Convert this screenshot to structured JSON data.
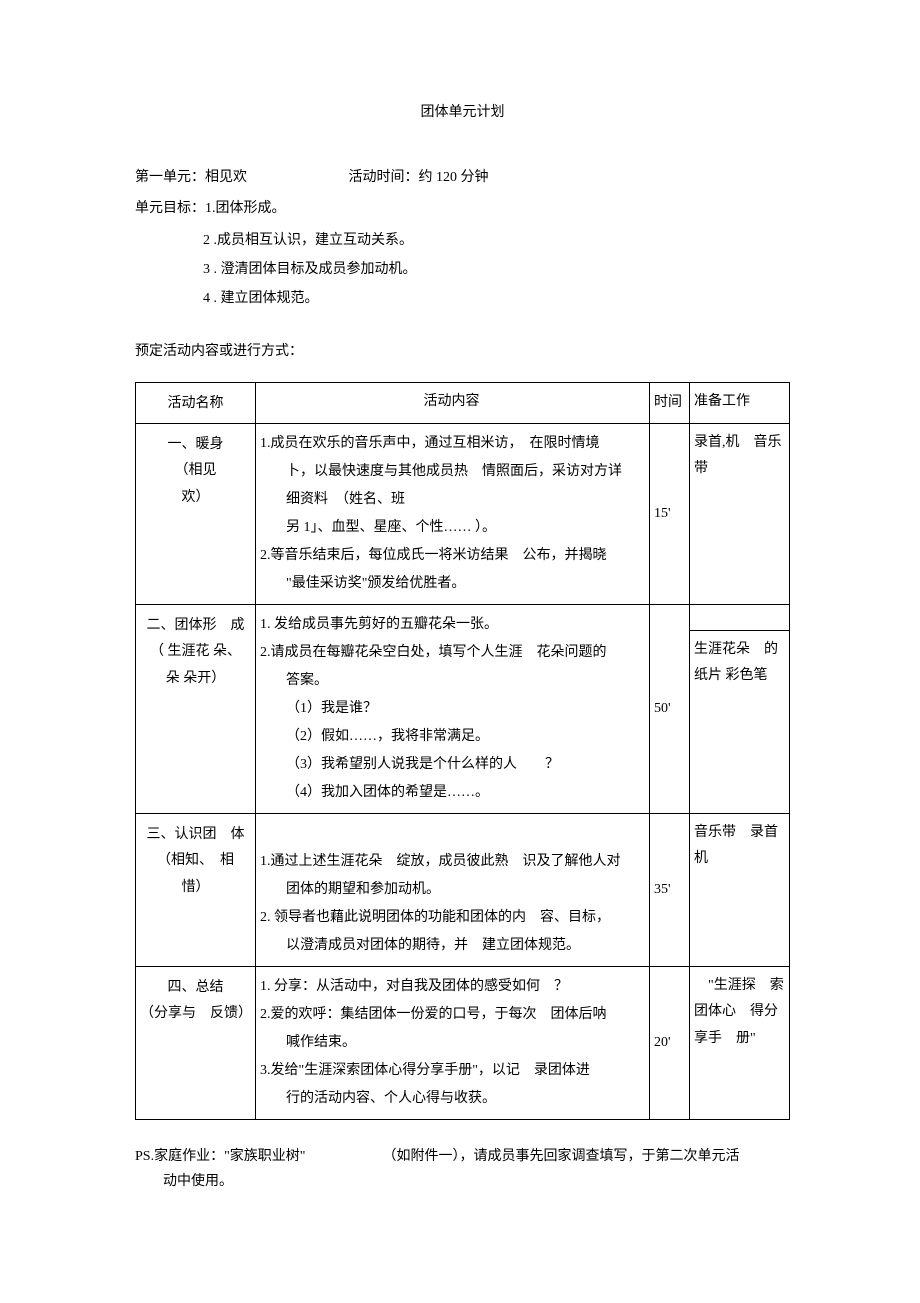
{
  "title": "团体单元计划",
  "header": {
    "unitLabel": "第一单元：相见欢",
    "timeLabel": "活动时间：约 120 分钟",
    "goalLabel": "单元目标：1.团体形成。",
    "goals": [
      "2 .成员相互认识，建立互动关系。",
      "3 . 澄清团体目标及成员参加动机。",
      "4 . 建立团体规范。"
    ]
  },
  "sectionLabel": "预定活动内容或进行方式：",
  "table": {
    "headers": {
      "name": "活动名称",
      "content": "活动内容",
      "time": "时间",
      "prep": "准备工作"
    },
    "rows": [
      {
        "name": [
          "一、暖身",
          "（相见",
          "欢）"
        ],
        "content": [
          {
            "text": "1.成员在欢乐的音乐声中，通过互相米访，　在限时情境",
            "cls": ""
          },
          {
            "text": "卜，以最快速度与其他成员热　情照面后，采访对方详",
            "cls": "indent"
          },
          {
            "text": "细资料　（姓名、班",
            "cls": "indent"
          },
          {
            "text": "另 1」、血型、星座、个性…… ）。",
            "cls": "indent"
          },
          {
            "text": "2.等音乐结束后，每位成氏一将米访结果　公布，并揭晓",
            "cls": ""
          },
          {
            "text": "\"最佳采访奖\"颁发给优胜者。",
            "cls": "indent"
          }
        ],
        "time": "15'",
        "prep": [
          "录首,机　音乐",
          "带"
        ],
        "prepSplit": false
      },
      {
        "name": [
          "二、团体形　成",
          "（ 生涯花 朵、",
          "朵 朵开）"
        ],
        "content": [
          {
            "text": "1. 发给成员事先剪好的五瓣花朵一张。",
            "cls": ""
          },
          {
            "text": "2.请成员在每瓣花朵空白处，填写个人生涯　花朵问题的",
            "cls": ""
          },
          {
            "text": "答案。",
            "cls": "indent"
          },
          {
            "text": "（1）我是谁？",
            "cls": "indent2"
          },
          {
            "text": "（2）假如……，我将非常满足。",
            "cls": "indent2"
          },
          {
            "text": "（3）我希望别人说我是个什么样的人　　？",
            "cls": "indent2"
          },
          {
            "text": "（4）我加入团体的希望是……。",
            "cls": "indent2"
          }
        ],
        "time": "50'",
        "prep": [
          "生涯花朵　的",
          "纸片 彩色笔"
        ],
        "prepSplit": true
      },
      {
        "name": [
          "三、认识团　体",
          "（相知、　相",
          "惜）"
        ],
        "content": [
          {
            "text": "",
            "cls": ""
          },
          {
            "text": "1.通过上述生涯花朵　绽放，成员彼此熟　识及了解他人对",
            "cls": ""
          },
          {
            "text": "团体的期望和参加动机。",
            "cls": "indent"
          },
          {
            "text": "2. 领导者也藉此说明团体的功能和团体的内　容、目标，",
            "cls": ""
          },
          {
            "text": "以澄清成员对团体的期待，并　建立团体规范。",
            "cls": "indent"
          }
        ],
        "time": "35'",
        "prep": [
          "音乐带　录首",
          "机"
        ],
        "prepSplit": false
      },
      {
        "name": [
          "四、总结",
          "（分享与　反馈）"
        ],
        "content": [
          {
            "text": "1. 分享：从活动中，对自我及团体的感受如何　？",
            "cls": ""
          },
          {
            "text": "2.爱的欢呼：集结团体一份爱的口号，于每次　团体后呐",
            "cls": ""
          },
          {
            "text": "喊作结束。",
            "cls": "indent"
          },
          {
            "text": "3.发给\"生涯深索团体心得分享手册\"，以记　录团体进",
            "cls": ""
          },
          {
            "text": "行的活动内容、个人心得与收获。",
            "cls": "indent"
          }
        ],
        "time": "20'",
        "prep": [
          "　\"生涯探　索",
          "团体心　得分",
          "享手　册\""
        ],
        "prepSplit": false
      }
    ]
  },
  "footnote": {
    "line1a": "PS.家庭作业：\"家族职业树\"",
    "line1b": "（如附件一），请成员事先回家调查填写，于第二次单元活",
    "line2": "动中使用。"
  }
}
